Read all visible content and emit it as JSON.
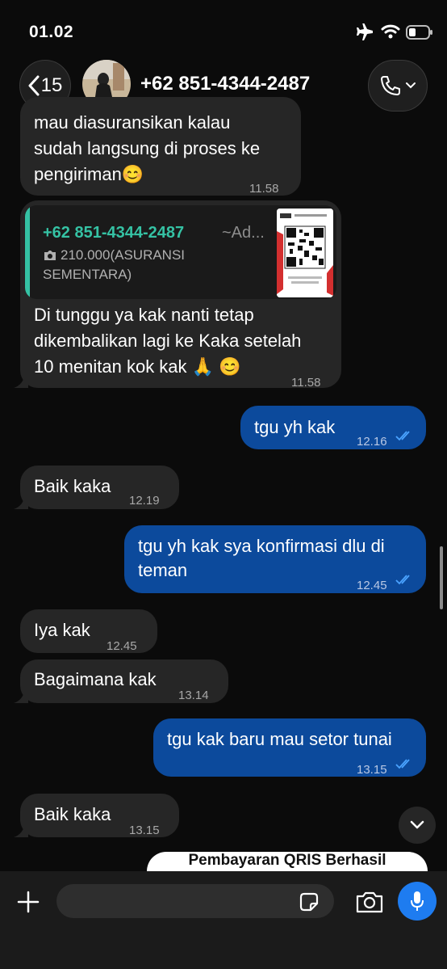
{
  "status_bar": {
    "time": "01.02"
  },
  "header": {
    "back_count": "15",
    "contact": "+62 851-4344-2487"
  },
  "messages": [
    {
      "text_lines": [
        "mau diasuransikan kalau",
        "sudah langsung di proses ke",
        "pengiriman😊"
      ],
      "time": "11.58"
    },
    {
      "quote": {
        "author": "+62 851-4344-2487",
        "suffix": "~Ad...",
        "text": "210.000(ASURANSI SEMENTARA)"
      },
      "text_lines": [
        "Di tunggu ya kak nanti tetap",
        "dikembalikan lagi ke Kaka setelah",
        "10 menitan kok kak 🙏 😊"
      ],
      "time": "11.58"
    },
    {
      "text": "tgu yh kak",
      "time": "12.16"
    },
    {
      "text": "Baik kaka",
      "time": "12.19"
    },
    {
      "text_lines": [
        "tgu yh kak sya konfirmasi dlu di",
        "teman"
      ],
      "time": "12.45"
    },
    {
      "text": "Iya kak",
      "time": "12.45"
    },
    {
      "text": "Bagaimana kak",
      "time": "13.14"
    },
    {
      "text": "tgu kak baru mau setor tunai",
      "time": "13.15"
    },
    {
      "text": "Baik kaka",
      "time": "13.15"
    }
  ],
  "card_peek": {
    "title": "Pembayaran QRIS Berhasil"
  },
  "icons": {
    "airplane": "airplane-icon",
    "wifi": "wifi-icon",
    "battery": "battery-icon",
    "back": "chevron-left-icon",
    "call": "phone-icon",
    "scroll_down": "chevron-down-icon",
    "plus": "plus-icon",
    "sticker": "sticker-icon",
    "camera": "camera-icon",
    "mic": "microphone-icon"
  },
  "colors": {
    "outgoing": "#0c4a9c",
    "incoming": "#262626",
    "accent": "#1e7cf0",
    "quote": "#35c2a4",
    "ticks": "#4aa3ff"
  }
}
